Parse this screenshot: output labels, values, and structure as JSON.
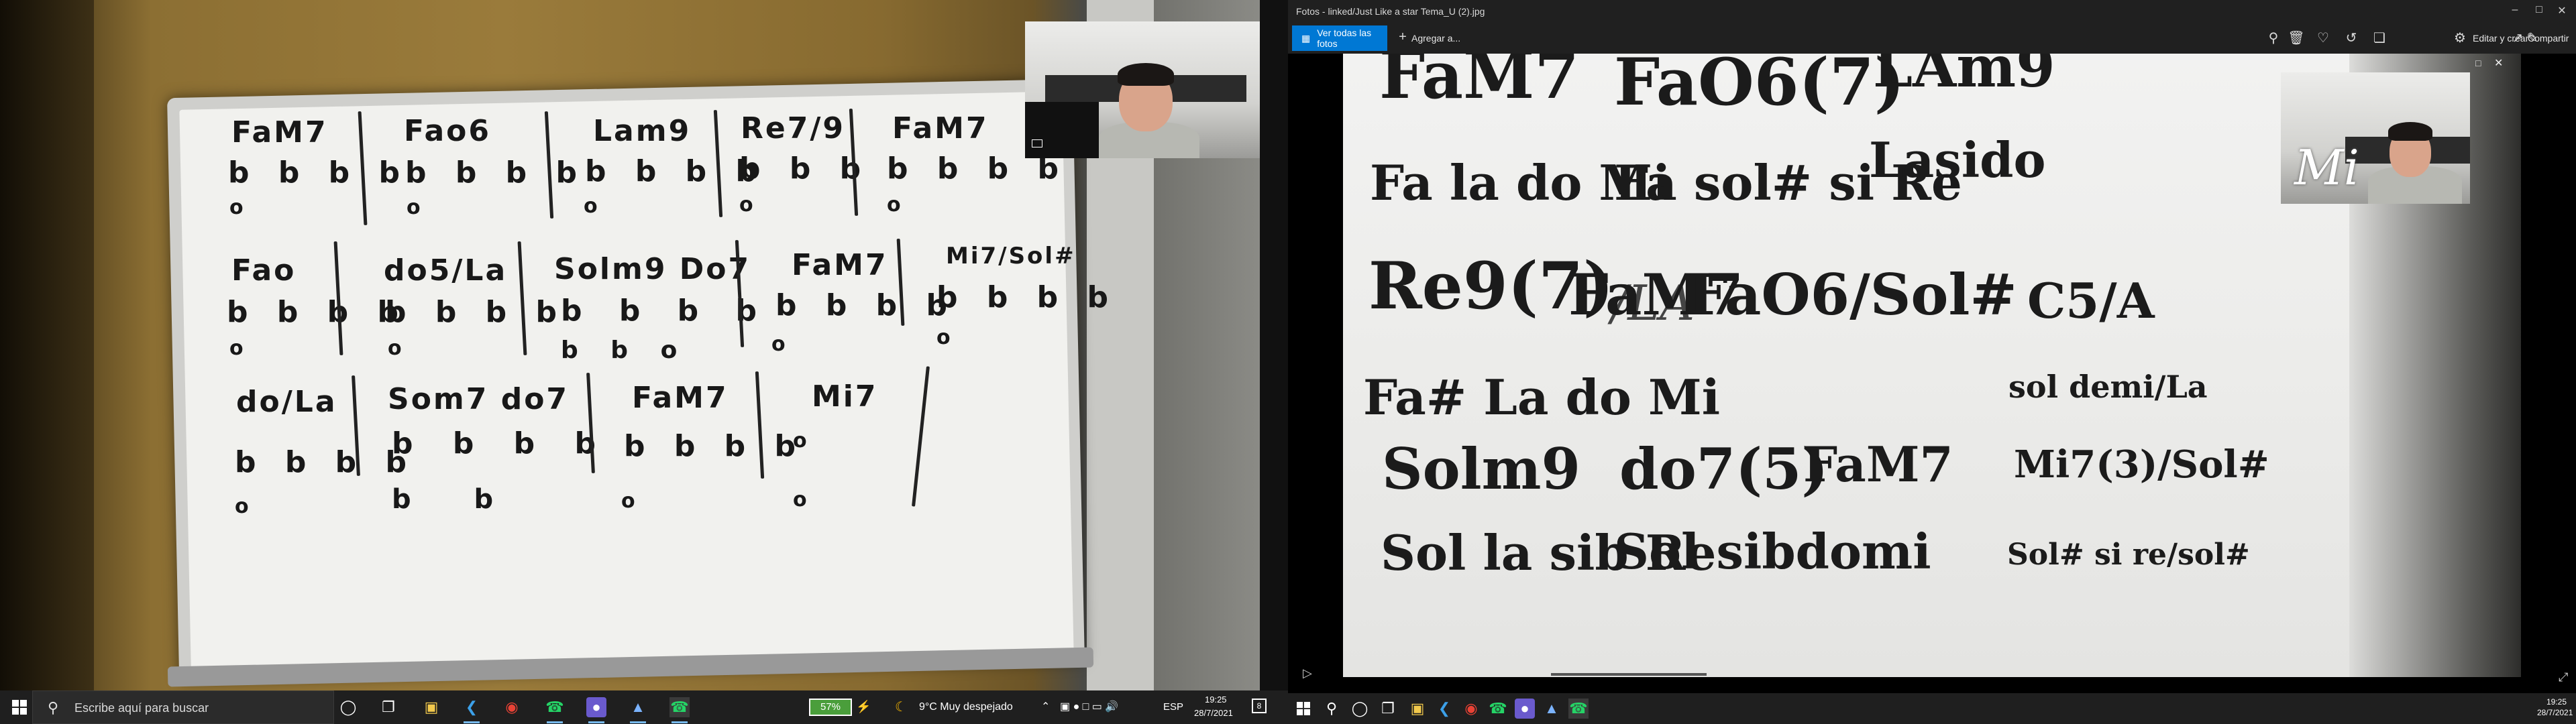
{
  "left_monitor": {
    "whiteboard": {
      "row1": [
        {
          "chord": "FaM7",
          "notes": "b b b b",
          "bass": "o"
        },
        {
          "chord": "Fao6",
          "notes": "b b b b",
          "bass": "o"
        },
        {
          "chord": "Lam9",
          "notes": "b b b b",
          "bass": "o"
        },
        {
          "chord": "Re7/9",
          "notes": "b b b",
          "bass": "o"
        },
        {
          "chord": "FaM7",
          "notes": "b b b b",
          "bass": "o"
        }
      ],
      "row2": [
        {
          "chord": "Fao",
          "notes": "b b b b",
          "bass": "o"
        },
        {
          "chord": "do5/La",
          "notes": "b b b b",
          "bass": "o"
        },
        {
          "chord": "Solm9  Do7",
          "notes": "b  b  b  b",
          "bass": "b   b   o"
        },
        {
          "chord": "FaM7",
          "notes": "b b b b",
          "bass": "o"
        },
        {
          "chord": "Mi7/Sol#",
          "notes": "b b b b",
          "bass": "o"
        }
      ],
      "row3": [
        {
          "chord": "do/La",
          "notes": "b b b b",
          "bass": "o"
        },
        {
          "chord": "Som7  do7",
          "notes": "b  b   b  b",
          "bass": "b    b"
        },
        {
          "chord": "FaM7",
          "notes": "b b b b",
          "bass": "o"
        },
        {
          "chord": "Mi7",
          "notes": "o",
          "bass": "o"
        }
      ]
    },
    "taskbar": {
      "search_placeholder": "Escribe aquí para buscar",
      "battery": "57%",
      "weather": "9°C  Muy despejado",
      "lang": "ESP",
      "time": "19:25",
      "date": "28/7/2021",
      "notif_count": "8"
    }
  },
  "right_monitor": {
    "title": "Fotos - linked/Just Like a star Tema_U (2).jpg",
    "toolbar": {
      "all_photos": "Ver todas las fotos",
      "add_to": "Agregar a...",
      "edit_create": "Editar y crear",
      "share": "Compartir"
    },
    "photo": {
      "lines": {
        "c1": "FaM7",
        "c2": "FaO6(7)",
        "c3": "LAm9",
        "n1": "Fa la do Mi",
        "n2": "Fa sol# si Re",
        "n3": "Lasido",
        "overlay_mi": "Mi",
        "c4": "Re9(7)",
        "c4b": "/LA",
        "c5": "FaM7",
        "c6": "FaO6/Sol#",
        "c7": "C5/A",
        "n4": "Fa# La do Mi",
        "n5": "sol demi/La",
        "c8": "Solm9",
        "c9": "do7(5)",
        "c10": "FaM7",
        "c11": "Mi7(3)/Sol#",
        "n6": "Sol la sib Re",
        "n7": "Sol sibdomi",
        "n8": "Sol# si re/sol#"
      }
    },
    "taskbar": {
      "time": "19:25",
      "date": "28/7/2021"
    }
  }
}
